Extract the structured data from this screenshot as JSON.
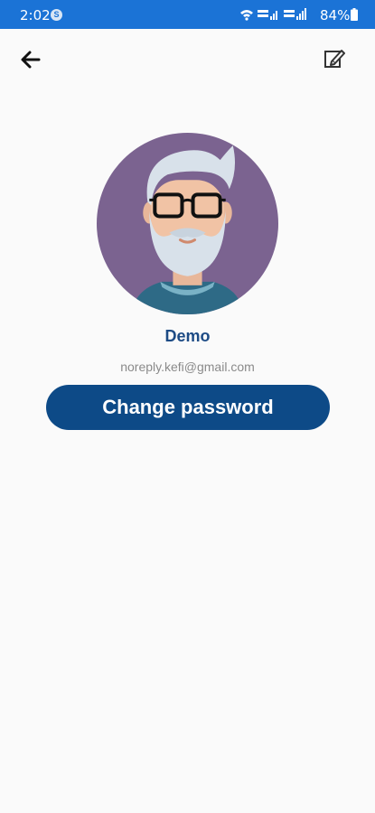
{
  "status_bar": {
    "time": "2:02",
    "notification_badge": "S",
    "battery": "84%",
    "icons": [
      "wifi-icon",
      "volte-signal-icon",
      "volte-signal-icon",
      "battery-icon"
    ]
  },
  "header": {
    "back_icon": "arrow-left-icon",
    "edit_icon": "edit-pencil-icon"
  },
  "profile": {
    "avatar_icon": "old-man-avatar-icon",
    "name": "Demo",
    "email": "noreply.kefi@gmail.com"
  },
  "actions": {
    "change_password_label": "Change password"
  },
  "colors": {
    "status_bar": "#1b73d6",
    "primary_button": "#0d4a87",
    "name_text": "#1d4b85",
    "avatar_bg": "#7b6390",
    "background": "#fafafa"
  }
}
